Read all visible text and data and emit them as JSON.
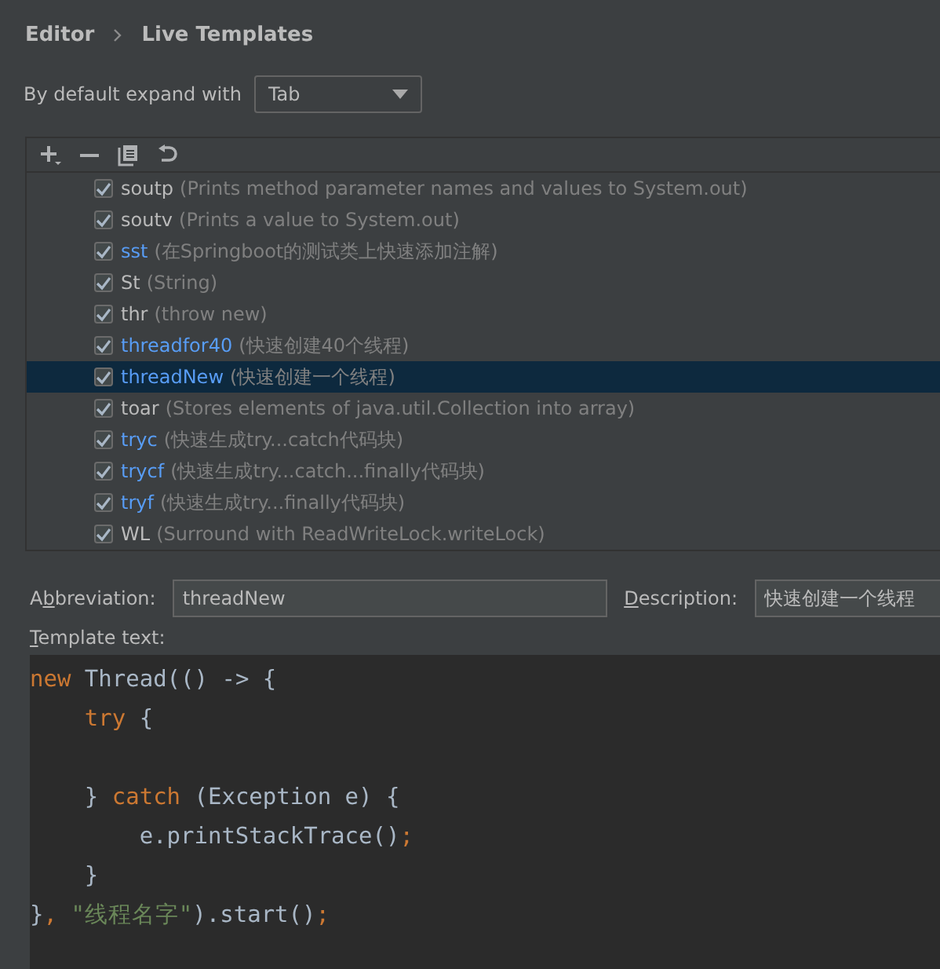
{
  "breadcrumb": [
    {
      "label": "Editor"
    },
    {
      "label": "Live Templates"
    }
  ],
  "expand": {
    "label": "By default expand with",
    "value": "Tab"
  },
  "toolbar": [
    {
      "kind": "add"
    },
    {
      "kind": "remove"
    },
    {
      "kind": "copy"
    },
    {
      "kind": "restore"
    }
  ],
  "templates": [
    {
      "abbreviation": "soutp",
      "description": "(Prints method parameter names and values to System.out)",
      "checked": true,
      "modified": false,
      "selected": false
    },
    {
      "abbreviation": "soutv",
      "description": "(Prints a value to System.out)",
      "checked": true,
      "modified": false,
      "selected": false
    },
    {
      "abbreviation": "sst",
      "description": "(在Springboot的测试类上快速添加注解)",
      "checked": true,
      "modified": true,
      "selected": false
    },
    {
      "abbreviation": "St",
      "description": "(String)",
      "checked": true,
      "modified": false,
      "selected": false
    },
    {
      "abbreviation": "thr",
      "description": "(throw new)",
      "checked": true,
      "modified": false,
      "selected": false
    },
    {
      "abbreviation": "threadfor40",
      "description": "(快速创建40个线程)",
      "checked": true,
      "modified": true,
      "selected": false
    },
    {
      "abbreviation": "threadNew",
      "description": "(快速创建一个线程)",
      "checked": true,
      "modified": true,
      "selected": true
    },
    {
      "abbreviation": "toar",
      "description": "(Stores elements of java.util.Collection into array)",
      "checked": true,
      "modified": false,
      "selected": false
    },
    {
      "abbreviation": "tryc",
      "description": "(快速生成try...catch代码块)",
      "checked": true,
      "modified": true,
      "selected": false
    },
    {
      "abbreviation": "trycf",
      "description": "(快速生成try...catch...finally代码块)",
      "checked": true,
      "modified": true,
      "selected": false
    },
    {
      "abbreviation": "tryf",
      "description": "(快速生成try...finally代码块)",
      "checked": true,
      "modified": true,
      "selected": false
    },
    {
      "abbreviation": "WL",
      "description": "(Surround with ReadWriteLock.writeLock)",
      "checked": true,
      "modified": false,
      "selected": false
    }
  ],
  "abbreviation": {
    "label": {
      "before": "A",
      "mnemonic": "b",
      "after": "breviation:"
    },
    "value": "threadNew"
  },
  "description": {
    "label": {
      "mnemonic": "D",
      "after": "escription:"
    },
    "value": "快速创建一个线程"
  },
  "template_text": {
    "label": {
      "mnemonic": "T",
      "after": "emplate text:"
    },
    "lines": [
      {
        "kind": "code",
        "tokens": [
          {
            "text": "new",
            "kind": "keyword"
          },
          {
            "text": " Thread(() -> {",
            "kind": "plain"
          }
        ],
        "children": [
          {
            "kind": "code",
            "tokens": [
              {
                "text": "try",
                "kind": "keyword"
              },
              {
                "text": " {",
                "kind": "plain"
              }
            ],
            "children": [
              {
                "kind": "blank"
              }
            ]
          },
          {
            "kind": "code",
            "tokens": [
              {
                "text": "} ",
                "kind": "plain"
              },
              {
                "text": "catch",
                "kind": "keyword"
              },
              {
                "text": " (Exception e) {",
                "kind": "plain"
              }
            ],
            "children": [
              {
                "kind": "code",
                "tokens": [
                  {
                    "text": "e.printStackTrace()",
                    "kind": "plain"
                  },
                  {
                    "text": ";",
                    "kind": "keyword"
                  }
                ]
              }
            ]
          },
          {
            "kind": "code",
            "tokens": [
              {
                "text": "}",
                "kind": "plain"
              }
            ]
          }
        ]
      },
      {
        "kind": "code",
        "tokens": [
          {
            "text": "}",
            "kind": "plain"
          },
          {
            "text": ", ",
            "kind": "keyword"
          },
          {
            "text": "\"线程名字\"",
            "kind": "string"
          },
          {
            "text": ").start()",
            "kind": "plain"
          },
          {
            "text": ";",
            "kind": "keyword"
          }
        ]
      }
    ]
  }
}
